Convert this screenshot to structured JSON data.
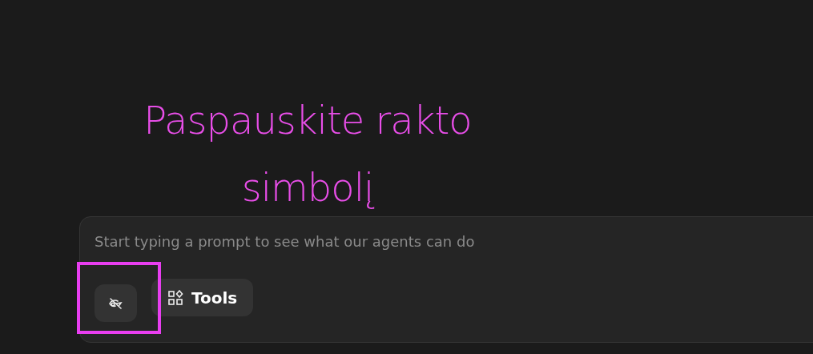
{
  "annotation": {
    "text": "Paspauskite rakto simbolį"
  },
  "prompt": {
    "placeholder": "Start typing a prompt to see what our agents can do"
  },
  "buttons": [
    {
      "kind": "icon",
      "highlighted": true
    },
    {
      "kind": "labeled",
      "label": "Tools",
      "highlighted": false
    }
  ]
}
